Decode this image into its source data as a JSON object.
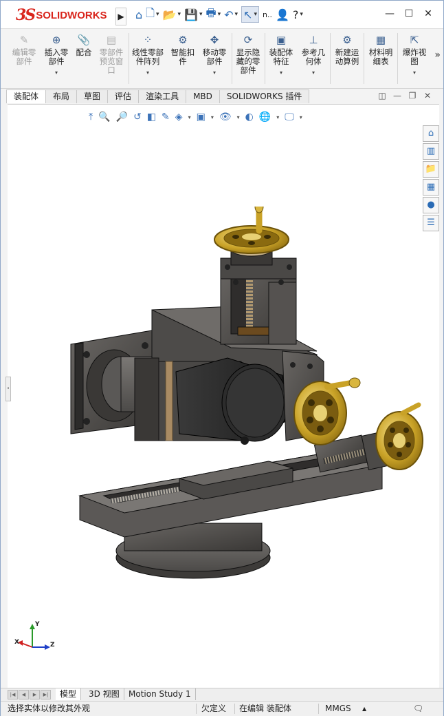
{
  "app": {
    "logo_mark": "3S",
    "brand": "SOLIDWORKS",
    "user_menu": "n..",
    "help": "?"
  },
  "quick_access": [
    {
      "icon": "home-icon"
    },
    {
      "icon": "new-document-icon"
    },
    {
      "icon": "open-icon"
    },
    {
      "icon": "save-icon"
    },
    {
      "icon": "print-icon"
    },
    {
      "icon": "undo-icon"
    },
    {
      "icon": "select-arrow-icon"
    }
  ],
  "ribbon": {
    "items": [
      {
        "label": "编辑零\n部件",
        "disabled": true
      },
      {
        "label": "插入零\n部件",
        "disabled": false
      },
      {
        "label": "配合",
        "disabled": false
      },
      {
        "label": "零部件\n预览窗\n口",
        "disabled": true
      },
      {
        "label": "线性零部\n件阵列",
        "disabled": false
      },
      {
        "label": "智能扣\n件",
        "disabled": false
      },
      {
        "label": "移动零\n部件",
        "disabled": false
      },
      {
        "label": "显示隐\n藏的零\n部件",
        "disabled": false
      },
      {
        "label": "装配体\n特征",
        "disabled": false
      },
      {
        "label": "参考几\n何体",
        "disabled": false
      },
      {
        "label": "新建运\n动算例",
        "disabled": false
      },
      {
        "label": "材料明\n细表",
        "disabled": false
      },
      {
        "label": "爆炸视\n图",
        "disabled": false
      }
    ],
    "more": "»"
  },
  "tabs": [
    "装配体",
    "布局",
    "草图",
    "评估",
    "渲染工具",
    "MBD",
    "SOLIDWORKS 插件"
  ],
  "active_tab": "装配体",
  "bottom_tabs": [
    "模型",
    "3D 视图",
    "Motion Study 1"
  ],
  "triad": {
    "x": "X",
    "y": "Y",
    "z": "Z"
  },
  "status": {
    "message": "选择实体以修改其外观",
    "constraint": "欠定义",
    "mode": "在编辑 装配体",
    "units": "MMGS",
    "units_arrow": "▲"
  },
  "colors": {
    "brand_red": "#d9251c",
    "brass": "#c9a227",
    "metal_dark": "#4a4846",
    "motor": "#2b2b2b"
  }
}
